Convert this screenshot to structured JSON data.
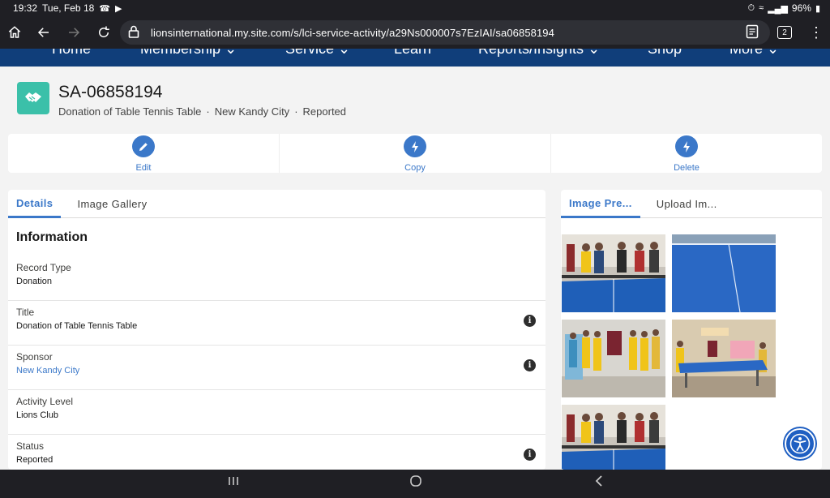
{
  "status_bar": {
    "time": "19:32",
    "date": "Tue, Feb 18",
    "battery": "96%"
  },
  "browser": {
    "url": "lionsinternational.my.site.com/s/lci-service-activity/a29Ns000007s7EzIAI/sa06858194",
    "tab_count": "2"
  },
  "site_nav": {
    "items": [
      "Home",
      "Membership",
      "Service",
      "Learn",
      "Reports/Insights",
      "Shop",
      "More"
    ]
  },
  "record": {
    "title": "SA-06858194",
    "subtitle_parts": [
      "Donation of Table Tennis Table",
      "New Kandy City",
      "Reported"
    ],
    "icon_color": "#3bc0a9"
  },
  "actions": [
    {
      "label": "Edit",
      "icon": "pencil-icon"
    },
    {
      "label": "Copy",
      "icon": "lightning-icon"
    },
    {
      "label": "Delete",
      "icon": "lightning-icon"
    }
  ],
  "details": {
    "tabs": [
      "Details",
      "Image Gallery"
    ],
    "section_title": "Information",
    "fields": [
      {
        "label": "Record Type",
        "value": "Donation",
        "info": false,
        "link": false
      },
      {
        "label": "Title",
        "value": "Donation of Table Tennis Table",
        "info": true,
        "link": false
      },
      {
        "label": "Sponsor",
        "value": "New Kandy City",
        "info": true,
        "link": true
      },
      {
        "label": "Activity Level",
        "value": "Lions Club",
        "info": false,
        "link": false
      },
      {
        "label": "Status",
        "value": "Reported",
        "info": true,
        "link": false
      }
    ]
  },
  "images": {
    "tabs": [
      "Image Pre...",
      "Upload Im..."
    ]
  },
  "colors": {
    "accent": "#3b78c9",
    "nav_blue": "#103e7a"
  }
}
